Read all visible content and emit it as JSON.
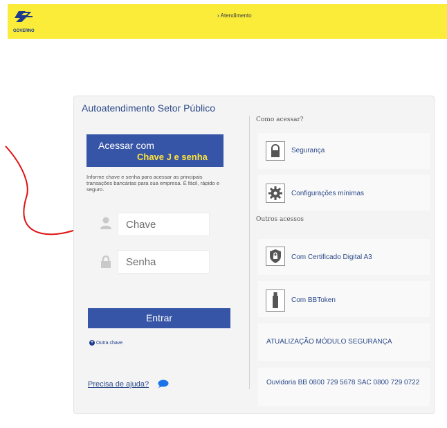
{
  "header": {
    "logo_text": "GOVERNO",
    "breadcrumb": "Atendimento"
  },
  "login": {
    "title": "Autoatendimento Setor Público",
    "banner_line1": "Acessar com",
    "banner_line2": "Chave J e senha",
    "info": "Informe chave e senha para acessar as principais transações bancárias para sua empresa. É fácil, rápido e seguro.",
    "key_placeholder": "Chave",
    "password_placeholder": "Senha",
    "enter_label": "Entrar",
    "other_key_label": "Outra chave",
    "help_label": "Precisa de ajuda?"
  },
  "how_to_access": {
    "label": "Como acessar?",
    "items": [
      {
        "label": "Segurança",
        "icon": "lock-icon"
      },
      {
        "label": "Configurações mínimas",
        "icon": "gear-icon"
      }
    ]
  },
  "other_access": {
    "label": "Outros acessos",
    "items": [
      {
        "label": "Com Certificado Digital A3",
        "icon": "shield-lock-icon"
      },
      {
        "label": "Com BBToken",
        "icon": "usb-token-icon"
      }
    ],
    "security_module": "ATUALIZAÇÃO MÓDULO SEGURANÇA",
    "ombudsman": "Ouvidoria BB 0800 729 5678 SAC 0800 729 0722"
  },
  "colors": {
    "header_yellow": "#fbec3a",
    "brand_blue": "#3755a6",
    "link_blue": "#2c4a8a",
    "highlight_yellow": "#ffe33b",
    "annotation_red": "#e01010"
  }
}
